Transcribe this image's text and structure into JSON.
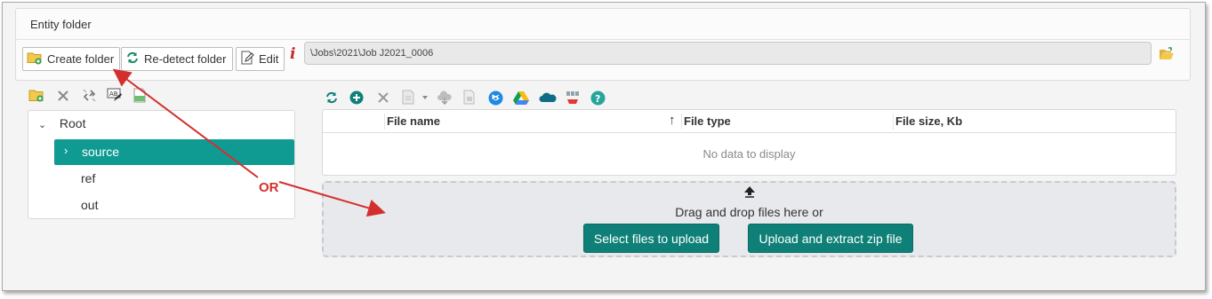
{
  "panel": {
    "title": "Entity folder"
  },
  "toolbar": {
    "create_folder": "Create folder",
    "redetect_folder": "Re-detect folder",
    "edit": "Edit",
    "info_glyph": "i",
    "path_value": "\\Jobs\\2021\\Job J2021_0006"
  },
  "tree": {
    "root": "Root",
    "items": [
      {
        "label": "source",
        "selected": true
      },
      {
        "label": "ref"
      },
      {
        "label": "out"
      }
    ]
  },
  "grid": {
    "columns": [
      "File name",
      "File type",
      "File size, Kb"
    ],
    "sort_indicator": "↑",
    "empty_text": "No data to display"
  },
  "upload": {
    "drop_text": "Drag and drop files here or",
    "select_button": "Select files to upload",
    "zip_button": "Upload and extract zip file"
  },
  "annotation": {
    "or_label": "OR"
  },
  "colors": {
    "accent": "#0f9b92",
    "button": "#0f8078",
    "annotation": "#d32f2f"
  }
}
